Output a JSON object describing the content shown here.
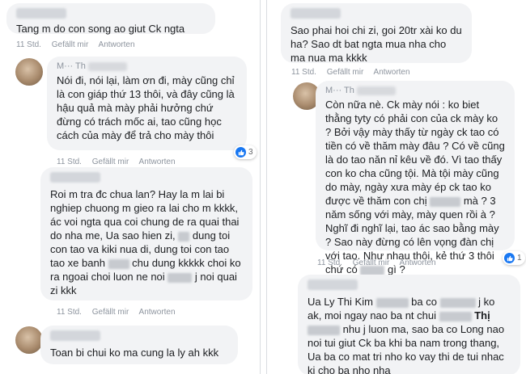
{
  "actions": {
    "like": "Gefällt mir",
    "reply": "Antworten"
  },
  "left": [
    {
      "author": "",
      "time": "11 Std.",
      "text": "Tang m do con song ao giut Ck ngta"
    },
    {
      "author": "M··· Th",
      "time": "11 Std.",
      "reacts": "3",
      "text": "Nói đi, nói lại, làm ơn đi, mày cũng chỉ là con giáp thứ 13 thôi, và đây cũng là hậu quả mà mày phải hưởng chứ đừng có trách mốc ai, tao cũng học cách của mày để trả cho mày thôi"
    },
    {
      "author": "",
      "time": "11 Std.",
      "text_parts": [
        "Roi m tra đc chua lan? Hay la m lai bi nghiep chuong m gieo ra lai cho m kkkk, ác voi ngta qua coi chung de ra quai thai do nha me, Ua sao hien zi, ",
        " dung toi con tao va kiki nua di, dung toi con tao tao xe banh ",
        " chu dung kkkkk choi ko ra ngoai choi luon ne noi ",
        " j noi quai zi kkk"
      ]
    },
    {
      "author": "",
      "time": "",
      "text": "Toan bi chui ko ma cung la ly ah kkk"
    }
  ],
  "right": [
    {
      "author": "",
      "time": "11 Std.",
      "text": "Sao phai hoi chi zi, goi 20tr xài ko du ha? Sao dt bat ngta mua nha cho ma nua ma kkkk"
    },
    {
      "author": "M··· Th",
      "time": "11 Std.",
      "reacts": "1",
      "text_parts": [
        "Còn nữa nè. Ck mày nói : ko biet thằng tyty có phải con của ck mày ko ? Bởi vậy mày thấy từ ngày ck tao có tiền có về thăm mày đâu ? Có về cũng là do tao năn nỉ kêu về đó. Vì tao thấy con ko cha cũng tội. Mà tội mày cũng do mày, ngày xưa mày ép ck tao ko được về thăm con chị ",
        " mà ? 3 năm sống với mày, mày quen rồi à ? Nghĩ đi nghĩ lại, tao ác sao bằng mày ? Sao này đừng có lên vọng đàn chị với tao. Như nhau thôi, kẻ thứ 3 thôi chứ có ",
        " gì ?"
      ]
    },
    {
      "author": "",
      "time": "",
      "text_parts": [
        "Ua Ly Thi Kim ",
        " ba co ",
        " j ko ak, moi ngay nao ba nt chui ",
        " ",
        " nhu j luon ma, sao ba co Long nao noi tui giut Ck ba khi ba nam trong thang, Ua ba co mat tri nho ko vay thi de tui nhac ki cho ba nho nha"
      ],
      "thi_label": "Thị"
    }
  ]
}
